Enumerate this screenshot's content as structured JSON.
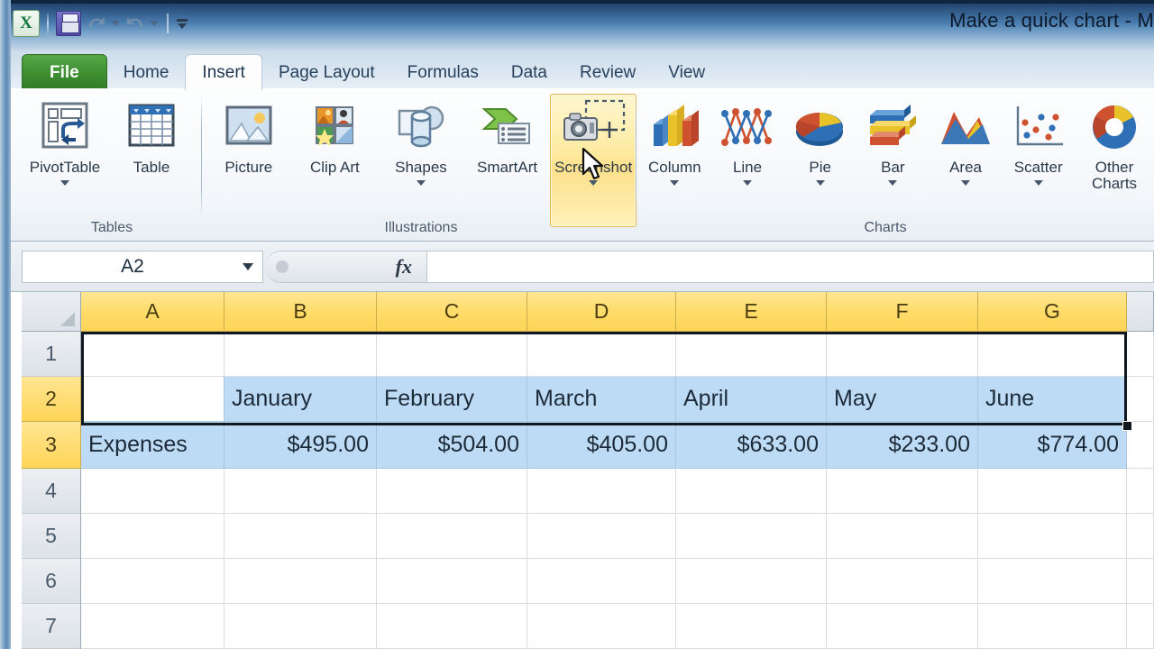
{
  "window": {
    "title": "Make a quick chart  -  M"
  },
  "qat": {
    "excel_logo": "X",
    "save_label": "save-icon",
    "undo_label": "undo-icon",
    "redo_label": "redo-icon",
    "customize_label": "customize-quick-access-toolbar"
  },
  "ribbon": {
    "tabs": [
      {
        "label": "File",
        "active": false,
        "file": true
      },
      {
        "label": "Home",
        "active": false
      },
      {
        "label": "Insert",
        "active": true
      },
      {
        "label": "Page Layout",
        "active": false
      },
      {
        "label": "Formulas",
        "active": false
      },
      {
        "label": "Data",
        "active": false
      },
      {
        "label": "Review",
        "active": false
      },
      {
        "label": "View",
        "active": false
      }
    ],
    "groups": [
      {
        "name": "Tables",
        "label": "Tables",
        "buttons": [
          {
            "label": "PivotTable",
            "icon": "pivot-table-icon",
            "dropdown": true
          },
          {
            "label": "Table",
            "icon": "table-icon",
            "dropdown": false
          }
        ]
      },
      {
        "name": "Illustrations",
        "label": "Illustrations",
        "buttons": [
          {
            "label": "Picture",
            "icon": "picture-icon",
            "dropdown": false
          },
          {
            "label": "Clip Art",
            "icon": "clip-art-icon",
            "dropdown": false
          },
          {
            "label": "Shapes",
            "icon": "shapes-icon",
            "dropdown": true
          },
          {
            "label": "SmartArt",
            "icon": "smartart-icon",
            "dropdown": false
          },
          {
            "label": "Screenshot",
            "icon": "screenshot-icon",
            "dropdown": true,
            "hovered": true
          }
        ]
      },
      {
        "name": "Charts",
        "label": "Charts",
        "buttons": [
          {
            "label": "Column",
            "icon": "column-chart-icon",
            "dropdown": true
          },
          {
            "label": "Line",
            "icon": "line-chart-icon",
            "dropdown": true
          },
          {
            "label": "Pie",
            "icon": "pie-chart-icon",
            "dropdown": true
          },
          {
            "label": "Bar",
            "icon": "bar-chart-icon",
            "dropdown": true
          },
          {
            "label": "Area",
            "icon": "area-chart-icon",
            "dropdown": true
          },
          {
            "label": "Scatter",
            "icon": "scatter-chart-icon",
            "dropdown": true
          },
          {
            "label": "Other Charts",
            "icon": "other-charts-icon",
            "dropdown": true
          }
        ]
      }
    ]
  },
  "formula_bar": {
    "name_box_value": "A2",
    "formula_value": "",
    "fx_label": "fx"
  },
  "sheet": {
    "column_headers": [
      "A",
      "B",
      "C",
      "D",
      "E",
      "F",
      "G"
    ],
    "row_headers": [
      "1",
      "2",
      "3",
      "4",
      "5",
      "6",
      "7"
    ],
    "selected_columns": [
      "A",
      "B",
      "C",
      "D",
      "E",
      "F",
      "G"
    ],
    "selected_rows": [
      "2",
      "3"
    ],
    "active_cell": "A2",
    "selection_range": "A2:G3",
    "rows": [
      {
        "row": "1",
        "cells": [
          "",
          "",
          "",
          "",
          "",
          "",
          ""
        ]
      },
      {
        "row": "2",
        "cells": [
          "",
          "January",
          "February",
          "March",
          "April",
          "May",
          "June"
        ]
      },
      {
        "row": "3",
        "cells": [
          "Expenses",
          "$495.00",
          "$504.00",
          "$405.00",
          "$633.00",
          "$233.00",
          "$774.00"
        ]
      },
      {
        "row": "4",
        "cells": [
          "",
          "",
          "",
          "",
          "",
          "",
          ""
        ]
      },
      {
        "row": "5",
        "cells": [
          "",
          "",
          "",
          "",
          "",
          "",
          ""
        ]
      },
      {
        "row": "6",
        "cells": [
          "",
          "",
          "",
          "",
          "",
          "",
          ""
        ]
      },
      {
        "row": "7",
        "cells": [
          "",
          "",
          "",
          "",
          "",
          "",
          ""
        ]
      }
    ]
  },
  "chart_data": {
    "type": "table",
    "title": "Expenses",
    "categories": [
      "January",
      "February",
      "March",
      "April",
      "May",
      "June"
    ],
    "series": [
      {
        "name": "Expenses",
        "values": [
          495.0,
          504.0,
          405.0,
          633.0,
          233.0,
          774.0
        ]
      }
    ],
    "xlabel": "",
    "ylabel": "Expenses",
    "value_format": "$#,##0.00"
  },
  "colors": {
    "header_selected": "#ffd457",
    "cell_selected": "#bedbf5",
    "hover_accent": "#fde08a",
    "file_tab": "#3f8f33",
    "titlebar": "#2c5481"
  }
}
